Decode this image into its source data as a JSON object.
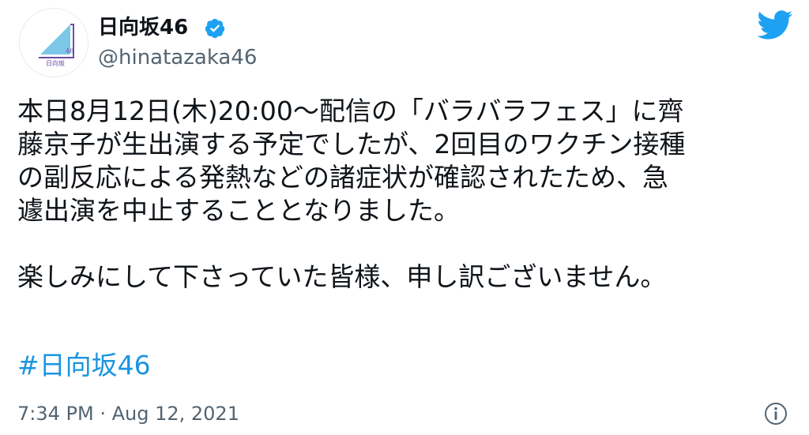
{
  "author": {
    "display_name": "日向坂46",
    "handle": "@hinatazaka46",
    "verified": true,
    "avatar_icon": "hinatazaka46-logo-icon",
    "avatar_text": "日向坂",
    "avatar_number": "46"
  },
  "tweet": {
    "lines": [
      "本日8月12日(木)20:00〜配信の「バラバラフェス」に齊",
      "藤京子が生出演する予定でしたが、2回目のワクチン接種",
      "の副反応による発熱などの諸症状が確認されたため、急",
      "遽出演を中止することとなりました。",
      "楽しみにして下さっていた皆様、申し訳ございません。"
    ],
    "hashtag": "#日向坂46",
    "timestamp": "7:34 PM · Aug 12, 2021"
  },
  "icons": {
    "verified": "verified-badge-icon",
    "twitter": "twitter-bird-icon",
    "info": "info-icon"
  },
  "colors": {
    "text": "#0f1419",
    "secondary": "#536471",
    "link": "#1b95e0",
    "twitter_blue": "#1da1f2",
    "avatar_blue": "#7cc7e8",
    "avatar_purple": "#6b4ea8"
  }
}
